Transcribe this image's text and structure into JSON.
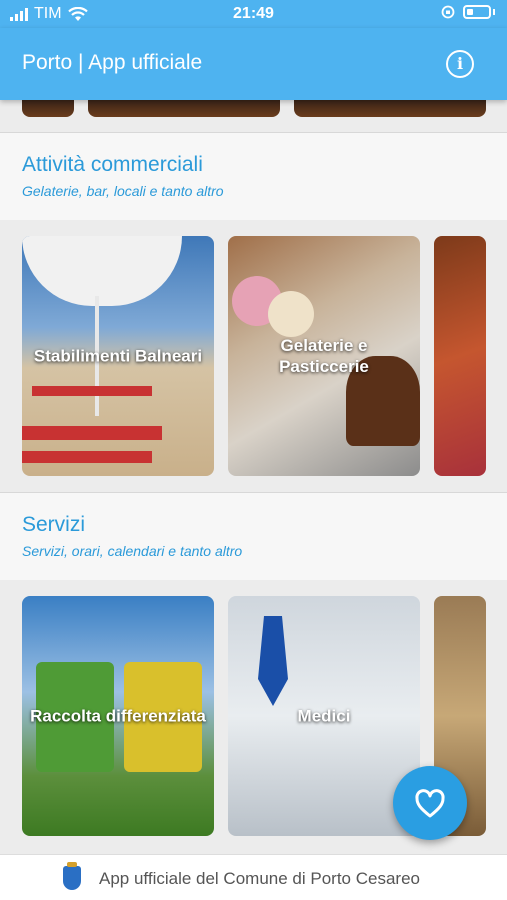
{
  "status_bar": {
    "carrier": "TIM",
    "time": "21:49"
  },
  "app_bar": {
    "title": "Porto | App ufficiale",
    "info_icon": "info-icon"
  },
  "sections": [
    {
      "heading": "Attività commerciali",
      "subtitle": "Gelaterie, bar, locali e tanto altro",
      "cards": [
        {
          "label": "Stabilimenti Balneari"
        },
        {
          "label": "Gelaterie e Pasticcerie"
        },
        {
          "label": ""
        }
      ]
    },
    {
      "heading": "Servizi",
      "subtitle": "Servizi, orari, calendari e tanto altro",
      "cards": [
        {
          "label": "Raccolta differenziata"
        },
        {
          "label": "Medici"
        },
        {
          "label": ""
        }
      ]
    }
  ],
  "fab": {
    "icon": "heart-icon"
  },
  "footer": {
    "text": "App ufficiale del Comune di Porto Cesareo",
    "crest_icon": "municipal-crest-icon"
  },
  "colors": {
    "primary": "#4eb3f0",
    "accent": "#2b9ad9",
    "fab": "#2a9ee2"
  }
}
